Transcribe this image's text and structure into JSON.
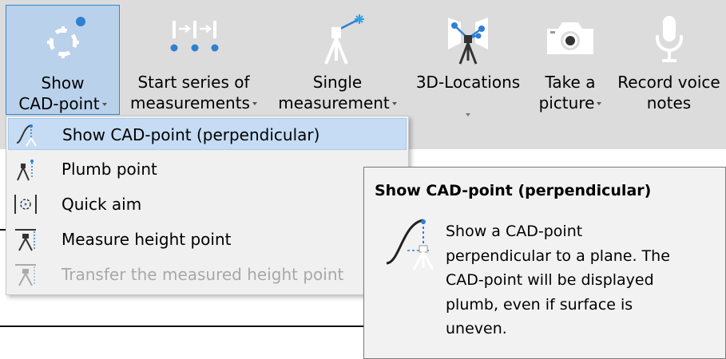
{
  "ribbon": {
    "buttons": [
      {
        "label_line1": "Show",
        "label_line2": "CAD-point",
        "has_dropdown": true,
        "icon": "crosshair-target-icon"
      },
      {
        "label_line1": "Start series of",
        "label_line2": "measurements",
        "has_dropdown": true,
        "icon": "series-measurement-icon"
      },
      {
        "label_line1": "Single",
        "label_line2": "measurement",
        "has_dropdown": true,
        "icon": "laser-tripod-icon"
      },
      {
        "label_line1": "3D-Locations",
        "label_line2": "",
        "has_dropdown": true,
        "icon": "3d-location-tripod-icon"
      },
      {
        "label_line1": "Take a",
        "label_line2": "picture",
        "has_dropdown": true,
        "icon": "camera-icon"
      },
      {
        "label_line1": "Record voice",
        "label_line2": "notes",
        "has_dropdown": false,
        "icon": "microphone-icon"
      }
    ]
  },
  "menu": {
    "items": [
      {
        "label": "Show CAD-point (perpendicular)",
        "icon": "cad-perpendicular-icon",
        "highlighted": true,
        "disabled": false
      },
      {
        "label": "Plumb point",
        "icon": "plumb-point-icon",
        "highlighted": false,
        "disabled": false
      },
      {
        "label": "Quick aim",
        "icon": "quick-aim-icon",
        "highlighted": false,
        "disabled": false
      },
      {
        "label": "Measure height point",
        "icon": "measure-height-icon",
        "highlighted": false,
        "disabled": false
      },
      {
        "label": "Transfer the measured height point",
        "icon": "transfer-height-icon",
        "highlighted": false,
        "disabled": true
      }
    ]
  },
  "tooltip": {
    "title": "Show CAD-point (perpendicular)",
    "body_lines": [
      "Show a CAD-point",
      "perpendicular to a plane. The",
      "CAD-point will be displayed",
      "plumb, even if surface is",
      "uneven."
    ]
  },
  "colors": {
    "ribbon_bg": "#dcdcdc",
    "active_bg": "#b9d1ea",
    "active_border": "#2e8ad6",
    "menu_highlight": "#c5dcf4",
    "accent_blue": "#2f7fd2"
  }
}
